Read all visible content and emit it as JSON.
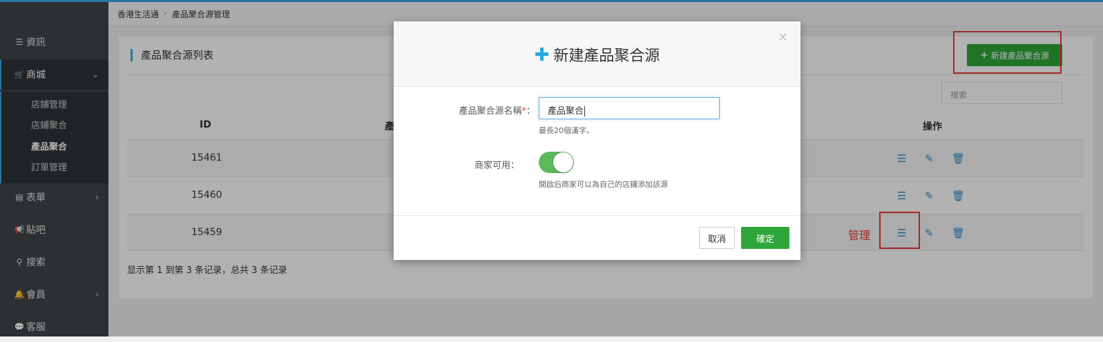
{
  "breadcrumb": [
    "香港生活通",
    "產品聚合源管理"
  ],
  "sidebar": {
    "items": [
      {
        "label": "資訊",
        "icon": "list-icon"
      },
      {
        "label": "商城",
        "icon": "cart-icon"
      },
      {
        "label": "表單",
        "icon": "form-icon"
      },
      {
        "label": "貼吧",
        "icon": "megaphone-icon"
      },
      {
        "label": "搜索",
        "icon": "search-icon"
      },
      {
        "label": "會員",
        "icon": "bell-icon"
      },
      {
        "label": "客服",
        "icon": "chat-icon"
      }
    ],
    "submenu": [
      "店鋪管理",
      "店鋪聚合",
      "產品聚合",
      "訂單管理"
    ]
  },
  "panel": {
    "title": "產品聚合源列表",
    "new_button": "新建產品聚合源",
    "search_placeholder": "搜索",
    "columns": {
      "id": "ID",
      "name_partial": "產",
      "actions": "操作"
    },
    "rows": [
      {
        "id": "15461"
      },
      {
        "id": "15460"
      },
      {
        "id": "15459"
      }
    ],
    "manage_annotation": "管理",
    "footer": "显示第 1 到第 3 条记录，总共 3 条记录"
  },
  "modal": {
    "title": "新建產品聚合源",
    "close": "×",
    "name_label": "產品聚合源名稱",
    "required_mark": "*",
    "label_colon": "：",
    "name_value": "產品聚合",
    "name_hint": "最長20個漢字。",
    "merchant_label": "商家可用：",
    "merchant_enabled": true,
    "merchant_hint": "開啟后商家可以為自己的店鋪添加該源",
    "cancel": "取消",
    "confirm": "確定"
  },
  "colors": {
    "accent": "#3ba8e6",
    "primary_green": "#2ea63a",
    "annotation_red": "#e53935",
    "sidebar_bg": "#3f4548"
  }
}
